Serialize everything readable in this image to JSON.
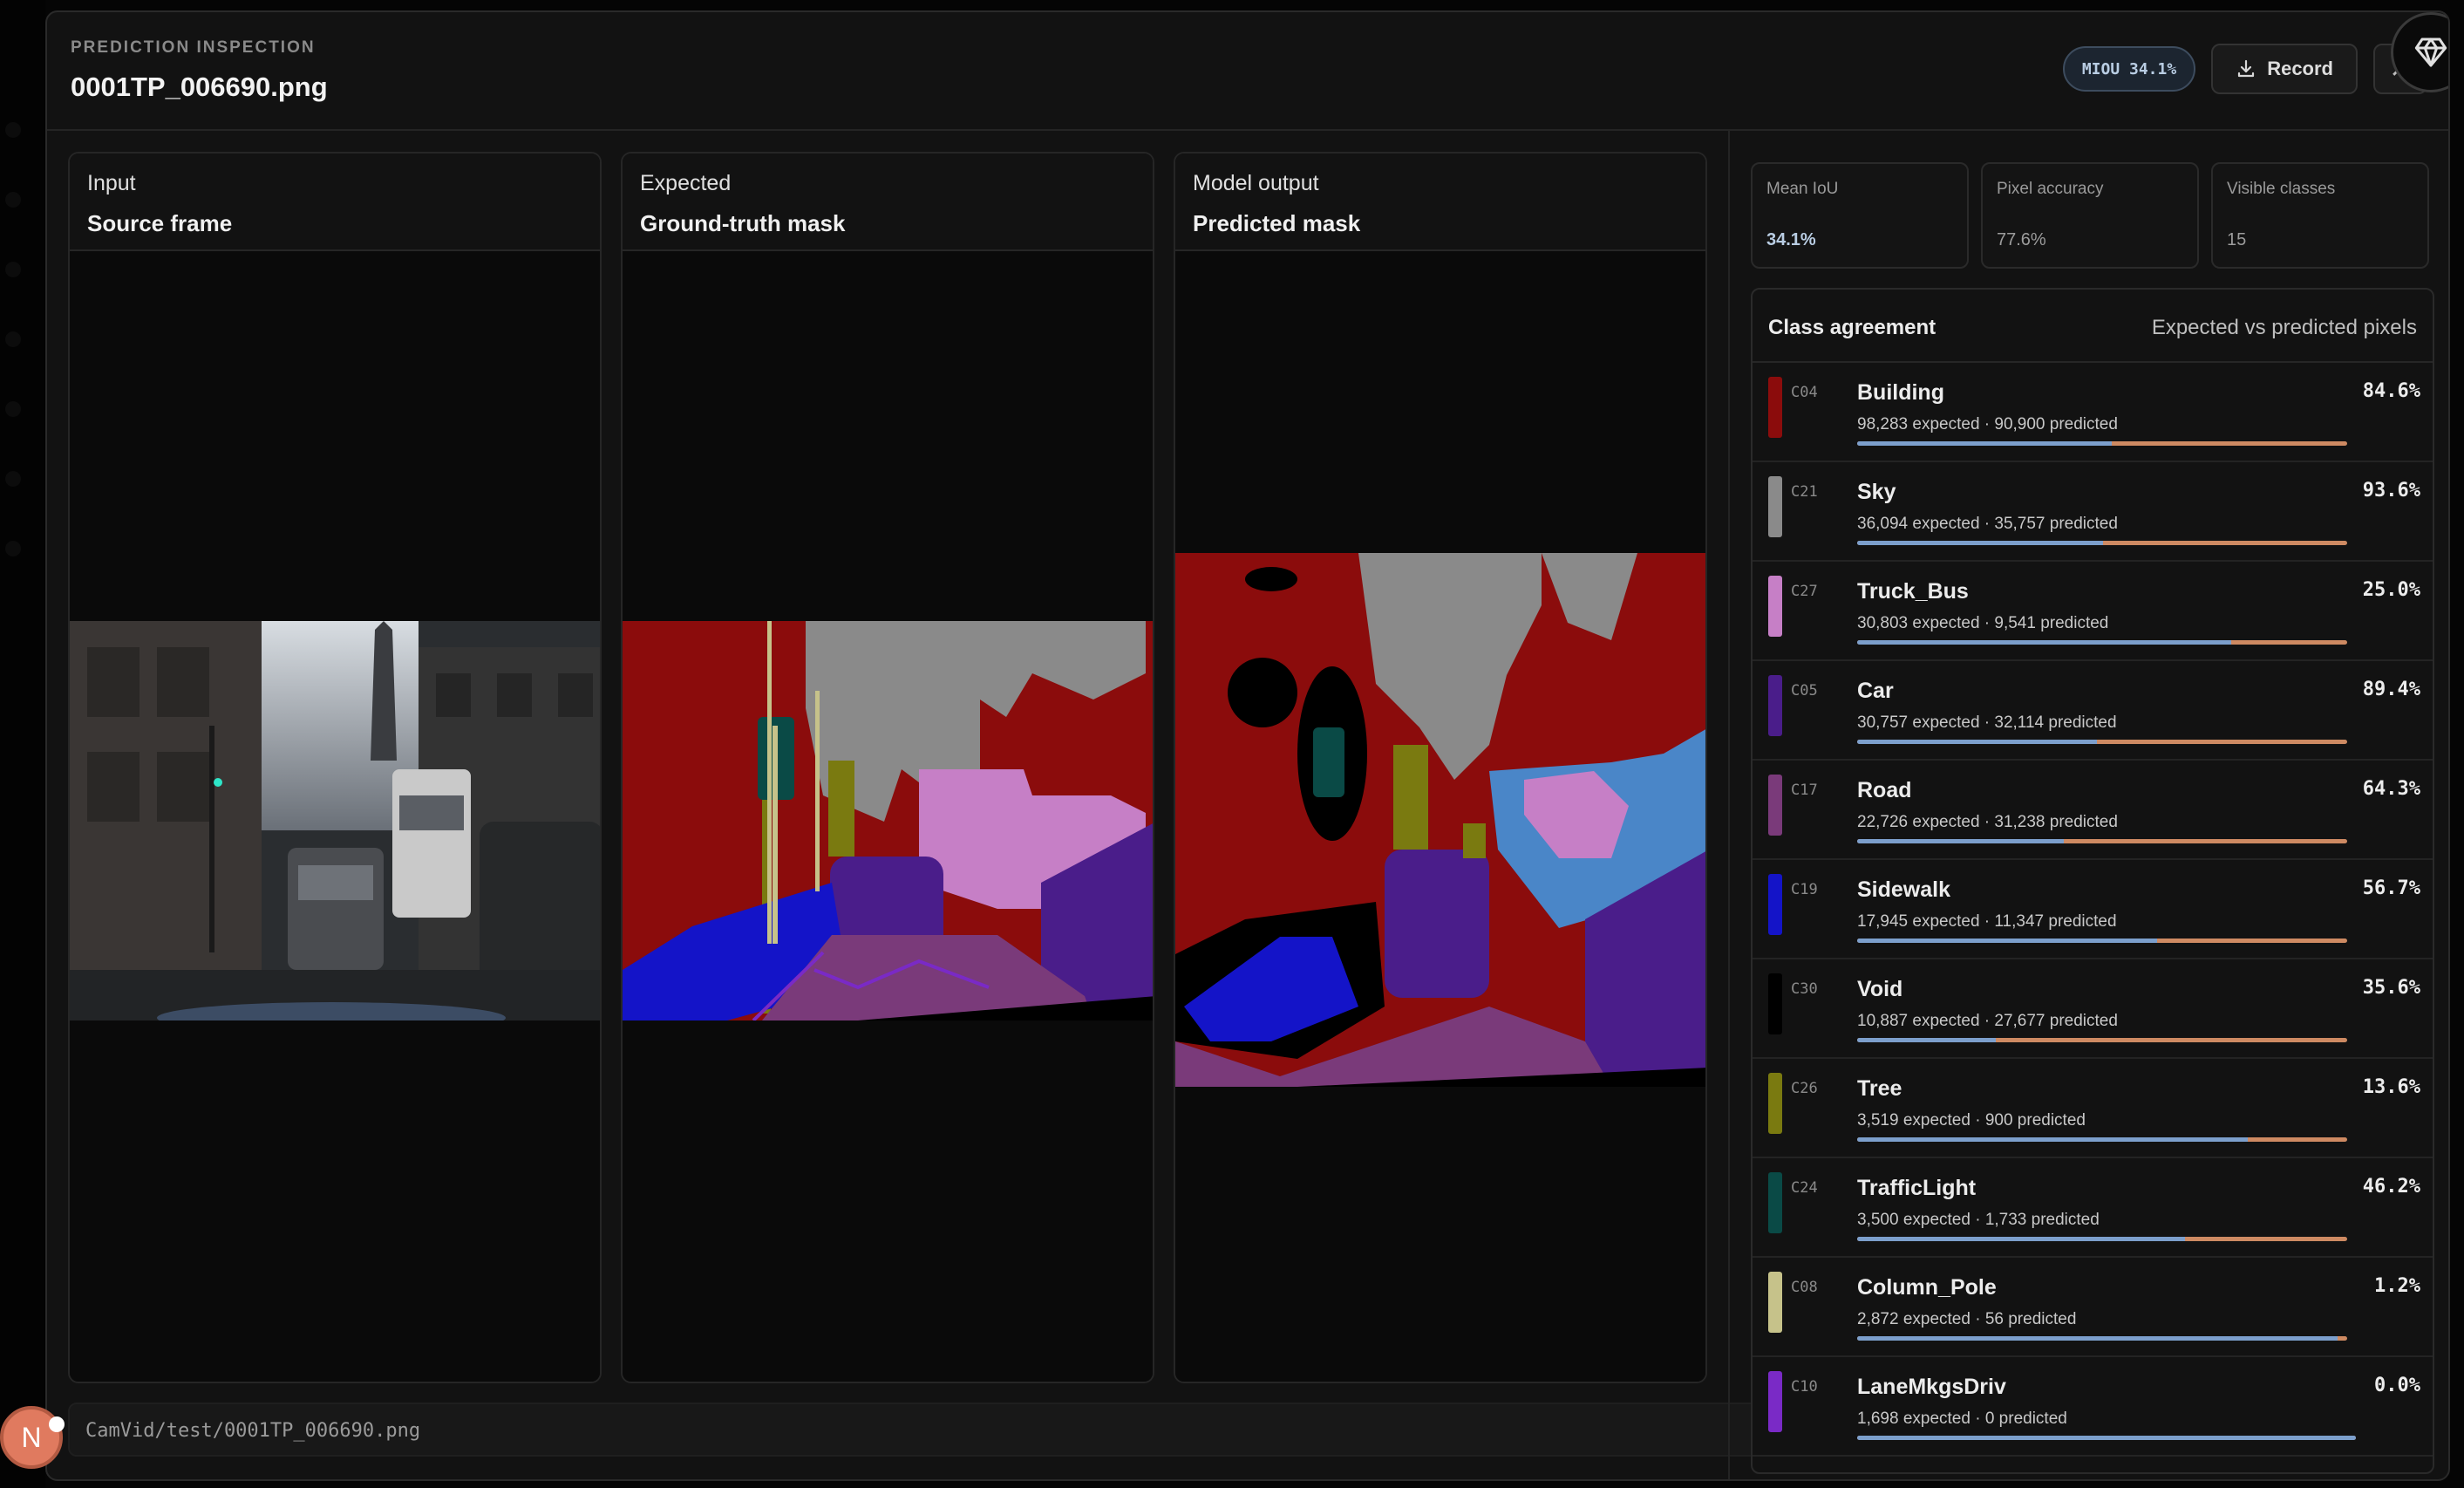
{
  "header": {
    "eyebrow": "PREDICTION INSPECTION",
    "title": "0001TP_006690.png",
    "miou_badge": "MIOU 34.1%",
    "record_label": "Record",
    "close_glyph": "✕"
  },
  "panels": [
    {
      "kicker": "Input",
      "subtitle": "Source frame"
    },
    {
      "kicker": "Expected",
      "subtitle": "Ground-truth mask"
    },
    {
      "kicker": "Model output",
      "subtitle": "Predicted mask"
    }
  ],
  "path": "CamVid/test/0001TP_006690.png",
  "avatar_initial": "N",
  "stats": [
    {
      "label": "Mean IoU",
      "value": "34.1%"
    },
    {
      "label": "Pixel accuracy",
      "value": "77.6%"
    },
    {
      "label": "Visible classes",
      "value": "15"
    }
  ],
  "agreement": {
    "title": "Class agreement",
    "note": "Expected vs predicted pixels",
    "rows": [
      {
        "code": "C04",
        "name": "Building",
        "counts": "98,283 expected · 90,900 predicted",
        "pct": "84.6%",
        "color": "#8b0c0c",
        "expected": 98283,
        "predicted": 90900
      },
      {
        "code": "C21",
        "name": "Sky",
        "counts": "36,094 expected · 35,757 predicted",
        "pct": "93.6%",
        "color": "#8a8a8a",
        "expected": 36094,
        "predicted": 35757
      },
      {
        "code": "C27",
        "name": "Truck_Bus",
        "counts": "30,803 expected · 9,541 predicted",
        "pct": "25.0%",
        "color": "#c67fc6",
        "expected": 30803,
        "predicted": 9541
      },
      {
        "code": "C05",
        "name": "Car",
        "counts": "30,757 expected · 32,114 predicted",
        "pct": "89.4%",
        "color": "#4a1d8a",
        "expected": 30757,
        "predicted": 32114
      },
      {
        "code": "C17",
        "name": "Road",
        "counts": "22,726 expected · 31,238 predicted",
        "pct": "64.3%",
        "color": "#7a3a7a",
        "expected": 22726,
        "predicted": 31238
      },
      {
        "code": "C19",
        "name": "Sidewalk",
        "counts": "17,945 expected · 11,347 predicted",
        "pct": "56.7%",
        "color": "#1414c8",
        "expected": 17945,
        "predicted": 11347
      },
      {
        "code": "C30",
        "name": "Void",
        "counts": "10,887 expected · 27,677 predicted",
        "pct": "35.6%",
        "color": "#000000",
        "expected": 10887,
        "predicted": 27677
      },
      {
        "code": "C26",
        "name": "Tree",
        "counts": "3,519 expected · 900 predicted",
        "pct": "13.6%",
        "color": "#7a7a10",
        "expected": 3519,
        "predicted": 900
      },
      {
        "code": "C24",
        "name": "TrafficLight",
        "counts": "3,500 expected · 1,733 predicted",
        "pct": "46.2%",
        "color": "#0a4a46",
        "expected": 3500,
        "predicted": 1733
      },
      {
        "code": "C08",
        "name": "Column_Pole",
        "counts": "2,872 expected · 56 predicted",
        "pct": "1.2%",
        "color": "#c6c28a",
        "expected": 2872,
        "predicted": 56
      },
      {
        "code": "C10",
        "name": "LaneMkgsDriv",
        "counts": "1,698 expected · 0 predicted",
        "pct": "0.0%",
        "color": "#7a2ac6",
        "expected": 1698,
        "predicted": 0
      }
    ]
  }
}
